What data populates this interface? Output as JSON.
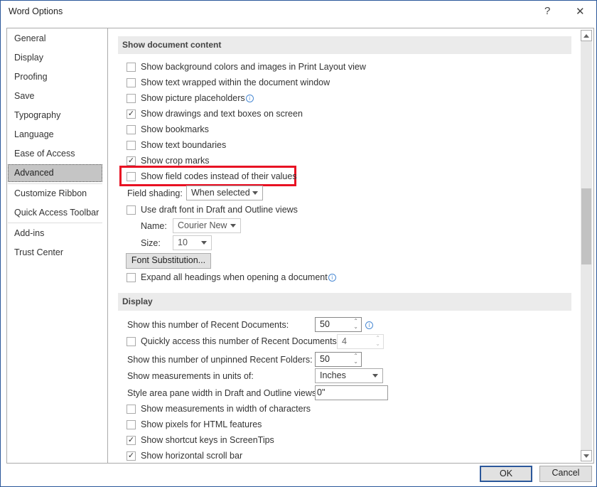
{
  "window": {
    "title": "Word Options",
    "help": "?",
    "close": "✕",
    "accent": "#2b579a"
  },
  "sidebar": {
    "items": [
      {
        "label": "General"
      },
      {
        "label": "Display"
      },
      {
        "label": "Proofing"
      },
      {
        "label": "Save"
      },
      {
        "label": "Typography"
      },
      {
        "label": "Language"
      },
      {
        "label": "Ease of Access"
      },
      {
        "label": "Advanced",
        "selected": true
      },
      {
        "label": "Customize Ribbon"
      },
      {
        "label": "Quick Access Toolbar"
      },
      {
        "label": "Add-ins"
      },
      {
        "label": "Trust Center"
      }
    ]
  },
  "show_document_content": {
    "heading": "Show document content",
    "options": [
      {
        "label": "Show background colors and images in Print Layout view",
        "checked": false
      },
      {
        "label": "Show text wrapped within the document window",
        "checked": false
      },
      {
        "label": "Show picture placeholders",
        "checked": false,
        "info": true
      },
      {
        "label": "Show drawings and text boxes on screen",
        "checked": true
      },
      {
        "label": "Show bookmarks",
        "checked": false
      },
      {
        "label": "Show text boundaries",
        "checked": false
      },
      {
        "label": "Show crop marks",
        "checked": true
      },
      {
        "label": "Show field codes instead of their values",
        "checked": false,
        "highlighted": true
      }
    ],
    "field_shading_label": "Field shading:",
    "field_shading_value": "When selected",
    "draft_font": {
      "label": "Use draft font in Draft and Outline views",
      "checked": false
    },
    "name_label": "Name:",
    "name_value": "Courier New",
    "size_label": "Size:",
    "size_value": "10",
    "font_substitution": "Font Substitution...",
    "expand_headings": {
      "label": "Expand all headings when opening a document",
      "checked": false
    }
  },
  "display": {
    "heading": "Display",
    "recent_docs_label": "Show this number of Recent Documents:",
    "recent_docs_value": "50",
    "quick_access": {
      "label": "Quickly access this number of Recent Documents:",
      "checked": false,
      "value": "4"
    },
    "recent_folders_label": "Show this number of unpinned Recent Folders:",
    "recent_folders_value": "50",
    "units_label": "Show measurements in units of:",
    "units_value": "Inches",
    "style_area_label": "Style area pane width in Draft and Outline views:",
    "style_area_value": "0\"",
    "options": [
      {
        "label": "Show measurements in width of characters",
        "checked": false
      },
      {
        "label": "Show pixels for HTML features",
        "checked": false
      },
      {
        "label": "Show shortcut keys in ScreenTips",
        "checked": true
      },
      {
        "label": "Show horizontal scroll bar",
        "checked": true
      }
    ]
  },
  "buttons": {
    "ok": "OK",
    "cancel": "Cancel"
  },
  "highlight_color": "#e81123"
}
